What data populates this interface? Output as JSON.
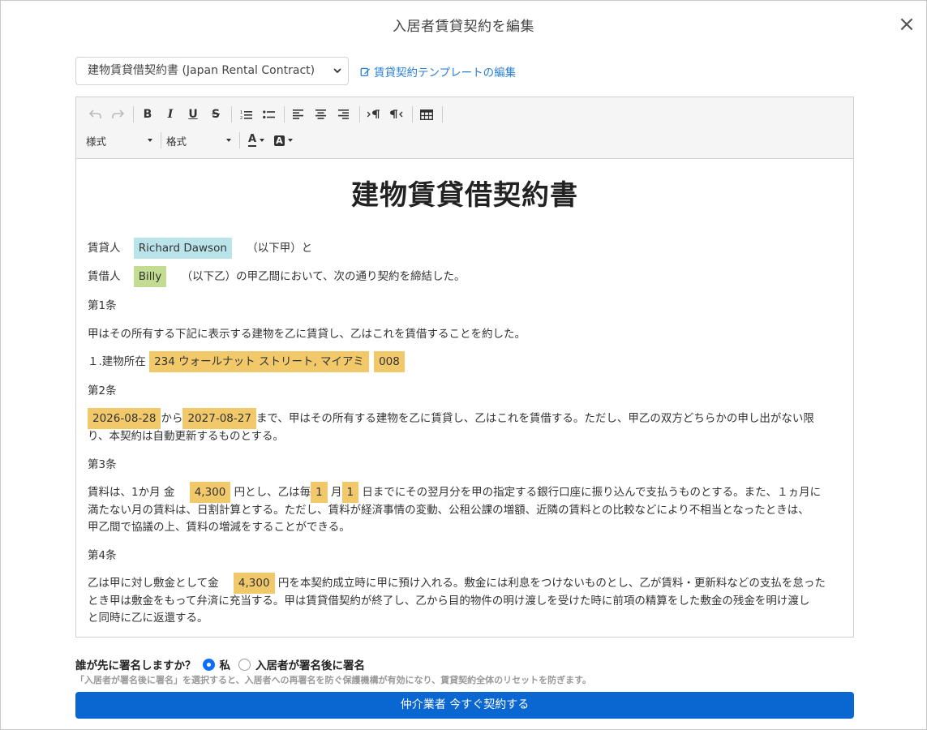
{
  "modal": {
    "title": "入居者賃貸契約を編集",
    "close_symbol": "×"
  },
  "template": {
    "selected": "建物賃貸借契約書 (Japan Rental Contract)",
    "edit_link": "賃貸契約テンプレートの編集"
  },
  "toolbar": {
    "bold": "B",
    "italic": "I",
    "underline": "U",
    "strike": "S",
    "style_dropdown": "様式",
    "format_dropdown": "格式",
    "font_color": "A",
    "bg_color": "A"
  },
  "document": {
    "title": "建物賃貸借契約書",
    "lessor_label": "賃貸人",
    "lessor_name": "Richard Dawson",
    "lessor_suffix": "（以下甲）と",
    "lessee_label": "賃借人",
    "lessee_name": "Billy",
    "lessee_suffix": "（以下乙）の甲乙間において、次の通り契約を締結した。",
    "art1_title": "第1条",
    "art1_text": "甲はその所有する下記に表示する建物を乙に賃貸し、乙はこれを賃借することを約した。",
    "art1_item_label": "１.建物所在",
    "address": "234 ウォールナット ストリート, マイアミ",
    "unit": "008",
    "art2_title": "第2条",
    "start_date": "2026-08-28",
    "from_text": "から",
    "end_date": "2027-08-27",
    "art2_text_a": "まで、甲はその所有する建物を乙に賃貸し、乙はこれを賃借する。ただし、甲乙の双方どちらかの申し出がない限",
    "art2_text_b": "り、本契約は自動更新するものとする。",
    "art3_title": "第3条",
    "art3_prefix": "賃料は、1か月 金",
    "rent": "4,300",
    "art3_mid1": "円とし、乙は毎",
    "pay_month": "1",
    "art3_mid2": "月",
    "pay_day": "1",
    "art3_text_a": "日までにその翌月分を甲の指定する銀行口座に振り込んで支払うものとする。また、１ヵ月に",
    "art3_text_b": "満たない月の賃料は、日割計算とする。ただし、賃料が経済事情の変動、公租公課の増額、近隣の賃料との比較などにより不相当となったときは、",
    "art3_text_c": "甲乙間で協議の上、賃料の増減をすることができる。",
    "art4_title": "第4条",
    "art4_prefix": "乙は甲に対し敷金として金",
    "deposit": "4,300",
    "art4_text_a": "円を本契約成立時に甲に預け入れる。敷金には利息をつけないものとし、乙が賃料・更新料などの支払を怠った",
    "art4_text_b": "とき甲は敷金をもって弁済に充当する。甲は賃貸借契約が終了し、乙から目的物件の明け渡しを受けた時に前項の精算をした敷金の残金を明け渡し",
    "art4_text_c": "と同時に乙に返還する。"
  },
  "signing": {
    "question": "誰が先に署名しますか？",
    "option_me": "私",
    "option_tenant": "入居者が署名後に署名",
    "selected": "私",
    "help": "「入居者が署名後に署名」を選択すると、入居者への再署名を防ぐ保護機構が有効になり、賃貸契約全体のリセットを防ぎます。"
  },
  "submit": {
    "label": "仲介業者 今すぐ契約する"
  },
  "colors": {
    "primary": "#0a66d1",
    "link": "#2a7fd4",
    "hl_lessor": "#b9e4ea",
    "hl_lessee": "#c2dc92",
    "hl_field": "#f2c96a"
  }
}
